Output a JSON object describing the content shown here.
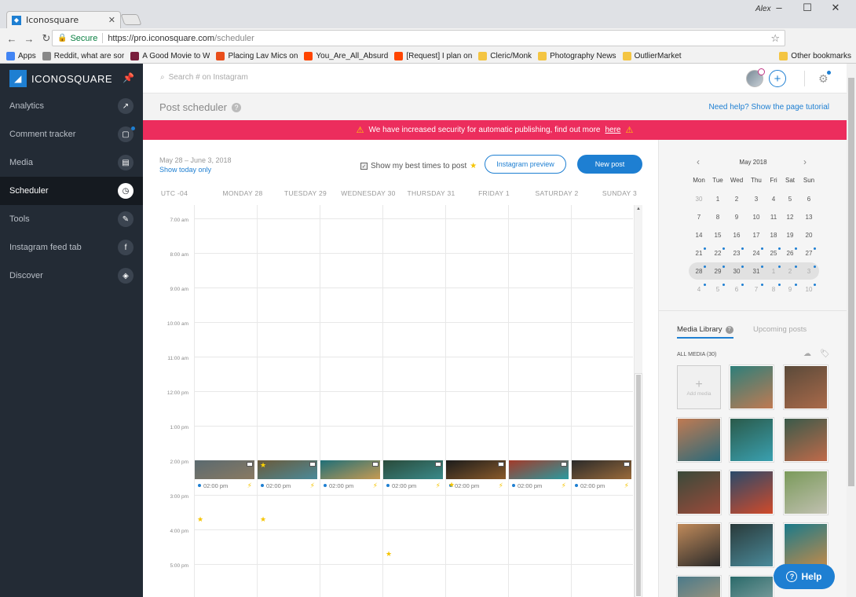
{
  "browser": {
    "tab_title": "Iconosquare",
    "user": "Alex",
    "secure_label": "Secure",
    "url_host": "https://pro.iconosquare.com",
    "url_path": "/scheduler",
    "bookmarks": [
      {
        "label": "Apps",
        "color": "#4285f4"
      },
      {
        "label": "Reddit, what are sor",
        "color": "#888"
      },
      {
        "label": "A Good Movie to W",
        "color": "#7a1f3d"
      },
      {
        "label": "Placing Lav Mics on",
        "color": "#e94e1b"
      },
      {
        "label": "You_Are_All_Absurd",
        "color": "#ff4500"
      },
      {
        "label": "[Request] I plan on",
        "color": "#ff4500"
      },
      {
        "label": "Cleric/Monk",
        "color": "#f4c542"
      },
      {
        "label": "Photography News",
        "color": "#f4c542"
      },
      {
        "label": "OutlierMarket",
        "color": "#f4c542"
      }
    ],
    "other_bookmarks": "Other bookmarks"
  },
  "sidebar": {
    "brand": "ICONOSQUARE",
    "items": [
      {
        "label": "Analytics",
        "icon": "chart-icon",
        "glyph": "↗"
      },
      {
        "label": "Comment tracker",
        "icon": "comment-icon",
        "glyph": "▢"
      },
      {
        "label": "Media",
        "icon": "media-icon",
        "glyph": "▤"
      },
      {
        "label": "Scheduler",
        "icon": "clock-icon",
        "glyph": "◷"
      },
      {
        "label": "Tools",
        "icon": "wrench-icon",
        "glyph": "✎"
      },
      {
        "label": "Instagram feed tab",
        "icon": "facebook-icon",
        "glyph": "f"
      },
      {
        "label": "Discover",
        "icon": "compass-icon",
        "glyph": "◈"
      }
    ],
    "active_index": 3
  },
  "topbar": {
    "search_placeholder": "Search # on Instagram"
  },
  "page": {
    "title": "Post scheduler",
    "tutorial_link": "Need help? Show the page tutorial",
    "alert_text": "We have increased security for automatic publishing, find out more",
    "alert_link": "here"
  },
  "scheduler": {
    "date_range": "May 28 – June 3, 2018",
    "show_today": "Show today only",
    "best_times_label": "Show my best times to post",
    "instagram_preview": "Instagram preview",
    "new_post": "New post",
    "timezone": "UTC -04",
    "days": [
      "MONDAY 28",
      "TUESDAY 29",
      "WEDNESDAY 30",
      "THURSDAY 31",
      "FRIDAY 1",
      "SATURDAY 2",
      "SUNDAY 3"
    ],
    "times": [
      "7:00 am",
      "8:00 am",
      "9:00 am",
      "10:00 am",
      "11:00 am",
      "12:00 pm",
      "1:00 pm",
      "2:00 pm",
      "3:00 pm",
      "4:00 pm",
      "5:00 pm"
    ],
    "posts": [
      {
        "time": "02:00 pm",
        "colors": [
          "#5a6a70",
          "#8a7a62"
        ],
        "star": false
      },
      {
        "time": "02:00 pm",
        "colors": [
          "#6b5a3a",
          "#4a8a9a"
        ],
        "star": true
      },
      {
        "time": "02:00 pm",
        "colors": [
          "#1f6f78",
          "#c79a52"
        ],
        "star": false
      },
      {
        "time": "02:00 pm",
        "colors": [
          "#2a4a3a",
          "#3a8a8a"
        ],
        "star": false
      },
      {
        "time": "02:00 pm",
        "colors": [
          "#1c1c1c",
          "#8a5a2a"
        ],
        "star": false
      },
      {
        "time": "02:00 pm",
        "colors": [
          "#a33a2a",
          "#2a9aa0"
        ],
        "star": false
      },
      {
        "time": "02:00 pm",
        "colors": [
          "#2a2a2a",
          "#9a6a3a"
        ],
        "star": false
      }
    ]
  },
  "calendar": {
    "month": "May 2018",
    "dow": [
      "Mon",
      "Tue",
      "Wed",
      "Thu",
      "Fri",
      "Sat",
      "Sun"
    ],
    "weeks": [
      [
        "30",
        "1",
        "2",
        "3",
        "4",
        "5",
        "6"
      ],
      [
        "7",
        "8",
        "9",
        "10",
        "11",
        "12",
        "13"
      ],
      [
        "14",
        "15",
        "16",
        "17",
        "18",
        "19",
        "20"
      ],
      [
        "21",
        "22",
        "23",
        "24",
        "25",
        "26",
        "27"
      ],
      [
        "28",
        "29",
        "30",
        "31",
        "1",
        "2",
        "3"
      ],
      [
        "4",
        "5",
        "6",
        "7",
        "8",
        "9",
        "10"
      ]
    ]
  },
  "media": {
    "tab_library": "Media Library",
    "tab_upcoming": "Upcoming posts",
    "all_media": "ALL MEDIA (30)",
    "add_media": "Add media",
    "thumbs": [
      [
        "#2e7f7a",
        "#c07a52"
      ],
      [
        "#5a4a3a",
        "#aa6a4a"
      ],
      [
        "#c07a52",
        "#2a6a7a"
      ],
      [
        "#2a5a4a",
        "#3aa0b0"
      ],
      [
        "#3a5a4a",
        "#c06a4a"
      ],
      [
        "#3a4a3a",
        "#9a4a3a"
      ],
      [
        "#2a4a6a",
        "#d04a2a"
      ],
      [
        "#7a9a5a",
        "#c0c0b0"
      ],
      [
        "#c08a5a",
        "#2a2a2a"
      ],
      [
        "#2a3a3a",
        "#4a8a9a"
      ],
      [
        "#1a7a8a",
        "#c08a4a"
      ],
      [
        "#4a7a8a",
        "#c0a07a"
      ],
      [
        "#2a6a6a",
        "#9ab0b0"
      ]
    ]
  },
  "help": {
    "label": "Help"
  }
}
